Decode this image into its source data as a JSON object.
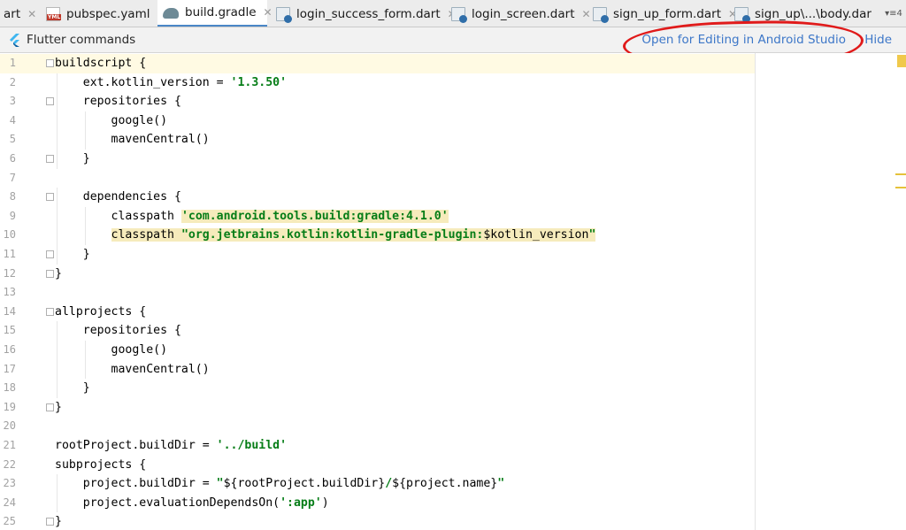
{
  "tabs": [
    {
      "label": "art",
      "icon": "none",
      "active": false
    },
    {
      "label": "pubspec.yaml",
      "icon": "yaml-file-icon",
      "active": false
    },
    {
      "label": "build.gradle",
      "icon": "gradle-file-icon",
      "active": true
    },
    {
      "label": "login_success_form.dart",
      "icon": "dart-file-icon",
      "active": false
    },
    {
      "label": "login_screen.dart",
      "icon": "dart-file-icon",
      "active": false
    },
    {
      "label": "sign_up_form.dart",
      "icon": "dart-file-icon",
      "active": false
    },
    {
      "label": "sign_up\\...\\body.dar",
      "icon": "dart-file-icon",
      "active": false
    }
  ],
  "tabs_overflow": "▾≡4",
  "banner": {
    "title": "Flutter commands",
    "open_in_android_studio": "Open for Editing in Android Studio",
    "hide": "Hide"
  },
  "editor": {
    "current_line": 1,
    "lines": [
      {
        "n": "1",
        "indent": 0,
        "parts": [
          {
            "t": "buildscript {"
          }
        ]
      },
      {
        "n": "2",
        "indent": 1,
        "parts": [
          {
            "t": "ext.kotlin_version = "
          },
          {
            "t": "'1.3.50'",
            "s": "str"
          }
        ]
      },
      {
        "n": "3",
        "indent": 1,
        "parts": [
          {
            "t": "repositories {"
          }
        ]
      },
      {
        "n": "4",
        "indent": 2,
        "parts": [
          {
            "t": "google()"
          }
        ]
      },
      {
        "n": "5",
        "indent": 2,
        "parts": [
          {
            "t": "mavenCentral()"
          }
        ]
      },
      {
        "n": "6",
        "indent": 1,
        "parts": [
          {
            "t": "}"
          }
        ]
      },
      {
        "n": "7",
        "indent": 0,
        "parts": []
      },
      {
        "n": "8",
        "indent": 1,
        "parts": [
          {
            "t": "dependencies {"
          }
        ]
      },
      {
        "n": "9",
        "indent": 2,
        "parts": [
          {
            "t": "classpath "
          },
          {
            "t": "'com.android.tools.build:gradle:4.1.0'",
            "s": "str hl"
          }
        ]
      },
      {
        "n": "10",
        "indent": 2,
        "parts": [
          {
            "t": "classpath ",
            "s": "hl"
          },
          {
            "t": "\"org.jetbrains.kotlin:kotlin-gradle-plugin:",
            "s": "str hl"
          },
          {
            "t": "$kotlin_version",
            "s": "hl"
          },
          {
            "t": "\"",
            "s": "str hl"
          }
        ]
      },
      {
        "n": "11",
        "indent": 1,
        "parts": [
          {
            "t": "}"
          }
        ]
      },
      {
        "n": "12",
        "indent": 0,
        "parts": [
          {
            "t": "}"
          }
        ]
      },
      {
        "n": "13",
        "indent": 0,
        "parts": []
      },
      {
        "n": "14",
        "indent": 0,
        "parts": [
          {
            "t": "allprojects {"
          }
        ]
      },
      {
        "n": "15",
        "indent": 1,
        "parts": [
          {
            "t": "repositories {"
          }
        ]
      },
      {
        "n": "16",
        "indent": 2,
        "parts": [
          {
            "t": "google()"
          }
        ]
      },
      {
        "n": "17",
        "indent": 2,
        "parts": [
          {
            "t": "mavenCentral()"
          }
        ]
      },
      {
        "n": "18",
        "indent": 1,
        "parts": [
          {
            "t": "}"
          }
        ]
      },
      {
        "n": "19",
        "indent": 0,
        "parts": [
          {
            "t": "}"
          }
        ]
      },
      {
        "n": "20",
        "indent": 0,
        "parts": []
      },
      {
        "n": "21",
        "indent": 0,
        "parts": [
          {
            "t": "rootProject.buildDir = "
          },
          {
            "t": "'../build'",
            "s": "str"
          }
        ]
      },
      {
        "n": "22",
        "indent": 0,
        "parts": [
          {
            "t": "subprojects {"
          }
        ]
      },
      {
        "n": "23",
        "indent": 1,
        "parts": [
          {
            "t": "project.buildDir = "
          },
          {
            "t": "\"",
            "s": "str"
          },
          {
            "t": "${rootProject.buildDir}"
          },
          {
            "t": "/",
            "s": "str"
          },
          {
            "t": "${project.name}"
          },
          {
            "t": "\"",
            "s": "str"
          }
        ]
      },
      {
        "n": "24",
        "indent": 1,
        "parts": [
          {
            "t": "project.evaluationDependsOn("
          },
          {
            "t": "':app'",
            "s": "str"
          },
          {
            "t": ")"
          }
        ]
      },
      {
        "n": "25",
        "indent": 0,
        "parts": [
          {
            "t": "}"
          }
        ]
      }
    ],
    "folds": [
      "1",
      "3",
      "6",
      "8",
      "11",
      "12",
      "14",
      "19",
      "25"
    ]
  },
  "colors": {
    "accent": "#4a87c7",
    "link": "#3d77c8",
    "string": "#067d17",
    "annotation": "#e01a1a",
    "current_line": "#fffae3"
  }
}
